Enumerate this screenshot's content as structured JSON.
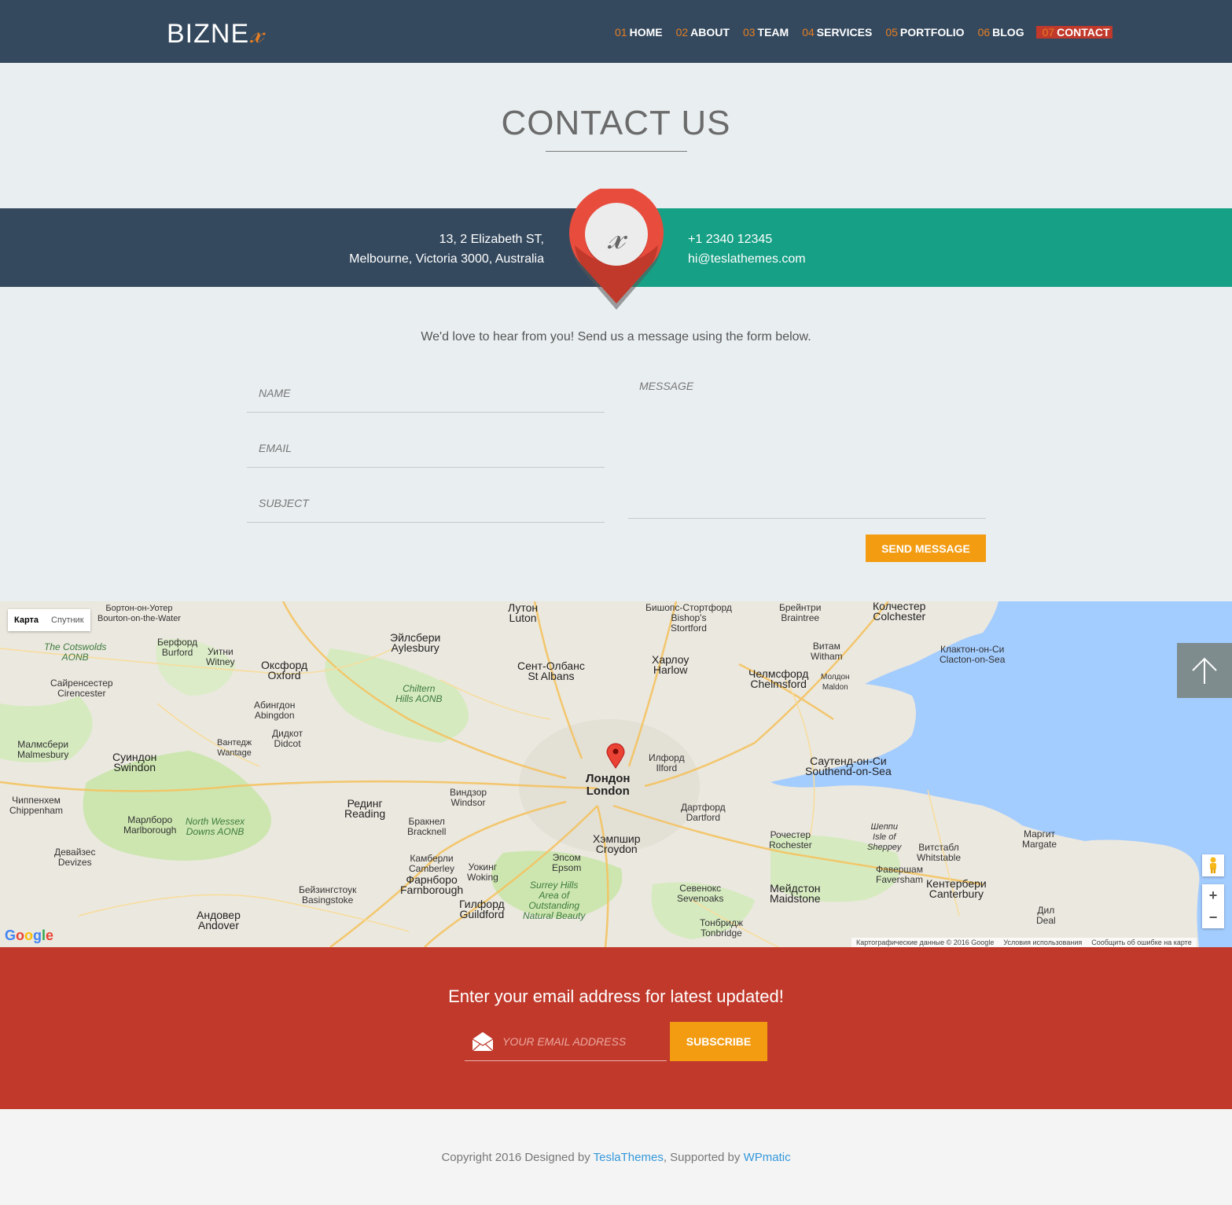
{
  "brand": {
    "logo_text": "BIZNE",
    "logo_mark": "X"
  },
  "nav": [
    {
      "num": "01",
      "label": "HOME"
    },
    {
      "num": "02",
      "label": "ABOUT"
    },
    {
      "num": "03",
      "label": "TEAM"
    },
    {
      "num": "04",
      "label": "SERVICES"
    },
    {
      "num": "05",
      "label": "PORTFOLIO"
    },
    {
      "num": "06",
      "label": "BLOG"
    },
    {
      "num": "07",
      "label": "CONTACT"
    }
  ],
  "contact": {
    "title": "CONTACT US",
    "address_line1": "13, 2 Elizabeth ST,",
    "address_line2": "Melbourne, Victoria 3000, Australia",
    "phone": "+1 2340 12345",
    "email": "hi@teslathemes.com",
    "intro": "We'd love to hear from you! Send us a message using the form below.",
    "form": {
      "name_placeholder": "NAME",
      "email_placeholder": "EMAIL",
      "subject_placeholder": "SUBJECT",
      "message_placeholder": "MESSAGE",
      "send_label": "SEND MESSAGE"
    }
  },
  "map": {
    "type_map": "Карта",
    "type_satellite": "Спутник",
    "zoom_in": "+",
    "zoom_out": "−",
    "google": [
      "G",
      "o",
      "o",
      "g",
      "l",
      "e"
    ],
    "attribution": "Картографические данные © 2016 Google",
    "terms": "Условия использования",
    "report": "Сообщить об ошибке на карте",
    "labels": {
      "luton": "Лутон\nLuton",
      "oxford": "Оксфорд\nOxford",
      "london": "Лондон\nLondon",
      "reading": "Рединг\nReading",
      "swindon": "Суиндон\nSwindon",
      "chelmsford": "Челмсфорд\nChelmsford",
      "southend": "Саутенд-он-Си\nSouthend-on-Sea",
      "croydon": "Хэмпшир\nCroydon",
      "guildford": "Гилфорд\nGuildford",
      "maidstone": "Мейдстон\nMaidstone",
      "canterbury": "Кентербери\nCanterbury",
      "aylesbury": "Эйлсбери\nAylesbury",
      "stalbans": "Сент-Олбанс\nSt Albans",
      "harlow": "Харлоу\nHarlow",
      "colchester": "Колчестер\nColchester",
      "clacton": "Клактон-он-Си\nClacton-on-Sea",
      "margate": "Маргит\nMargate",
      "dartford": "Дартфорд\nDartford",
      "basingstoke": "Бейзингстоук\nBasingstoke",
      "bracknell": "Бракнел\nBracknell",
      "woking": "Уокинг\nWoking",
      "epsom": "Эпсом\nEpsom",
      "tonbridge": "Тонбридж\nTonbridge",
      "sevenoaks": "Севенокс\nSevenoaks",
      "rochester": "Рочестер\nRochester",
      "chippenham": "Чиппенхем\nChippenham",
      "marlborough": "Марлборо\nMarlborough",
      "abingdon": "Абингдон\nAbingdon",
      "witney": "Уитни\nWitney",
      "cirencester": "Сайренсестер\nCirencester",
      "malmesbury": "Малмсбери\nMalmesbury",
      "andover": "Андовер\nAndover",
      "braintree": "Брейнтри\nBraintree",
      "bishops": "Бишопс-Стортфорд\nBishop's\nStortford",
      "witham": "Витам\nWitham",
      "maldon": "Молдон\nMaldon",
      "ilford": "Илфорд\nIlford",
      "windsor": "Виндзор\nWindsor",
      "camberley": "Камберли\nCamberley",
      "farnborough": "Фарнборо\nFarnborough",
      "faversham": "Фавершам\nFaversham",
      "whitstable": "Витстабл\nWhitstable",
      "deal": "Дил\nDeal",
      "devizes": "Девайзес\nDevizes",
      "wantage": "Вантедж\nWantage",
      "didcot": "Дидкот\nDidcot",
      "burford": "Берфорд\nBurford",
      "bourton": "Бортон-он-Уотер\nBourton-on-the-Water",
      "cotswolds": "The Cotswolds\nAONB",
      "chiltern": "Chiltern\nHills AONB",
      "nwessex": "North Wessex\nDowns AONB",
      "surrey": "Surrey Hills\nArea of\nOutstanding\nNatural Beauty",
      "sheppey": "Шеппи\nIsle of\nSheppey"
    }
  },
  "newsletter": {
    "title": "Enter your email address for latest updated!",
    "placeholder": "YOUR EMAIL ADDRESS",
    "button": "SUBSCRIBE"
  },
  "footer": {
    "prefix": "Copyright 2016 Designed by ",
    "designer": "TeslaThemes",
    "middle": ", Supported by ",
    "supporter": "WPmatic"
  },
  "colors": {
    "header_bg": "#34495e",
    "accent_orange": "#f39c12",
    "nav_number": "#e67e22",
    "active_nav": "#c0392b",
    "teal": "#16a085",
    "newsletter_bg": "#c0392b",
    "link": "#3498db"
  }
}
